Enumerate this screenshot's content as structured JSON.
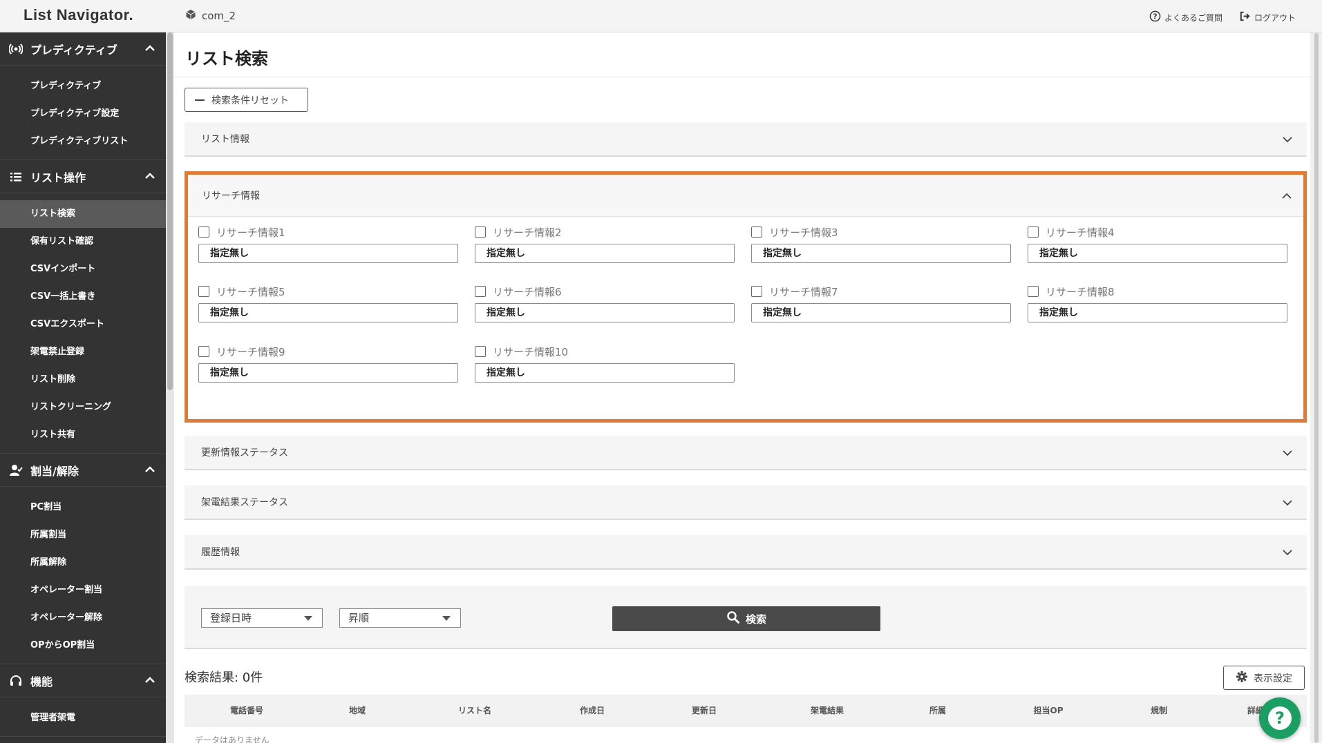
{
  "header": {
    "logo": "List Navigator.",
    "company": "com_2",
    "faq_label": "よくあるご質問",
    "logout_label": "ログアウト"
  },
  "sidebar": {
    "sections": [
      {
        "title": "プレディクティブ",
        "icon": "signal-icon",
        "items": [
          "プレディクティブ",
          "プレディクティブ設定",
          "プレディクティブリスト"
        ]
      },
      {
        "title": "リスト操作",
        "icon": "list-icon",
        "items": [
          "リスト検索",
          "保有リスト確認",
          "CSVインポート",
          "CSV一括上書き",
          "CSVエクスポート",
          "架電禁止登録",
          "リスト削除",
          "リストクリーニング",
          "リスト共有"
        ]
      },
      {
        "title": "割当/解除",
        "icon": "user-check-icon",
        "items": [
          "PC割当",
          "所属割当",
          "所属解除",
          "オペレーター割当",
          "オペレーター解除",
          "OPからOP割当"
        ]
      },
      {
        "title": "機能",
        "icon": "headset-icon",
        "items": [
          "管理者架電"
        ]
      }
    ],
    "active_item": "リスト検索"
  },
  "main": {
    "title": "リスト検索",
    "reset_label": "検索条件リセット",
    "accordions": {
      "list_info": "リスト情報",
      "research_info": "リサーチ情報",
      "update_status": "更新情報ステータス",
      "call_result_status": "架電結果ステータス",
      "history": "履歴情報"
    },
    "research_fields": [
      {
        "label": "リサーチ情報1",
        "value": "指定無し"
      },
      {
        "label": "リサーチ情報2",
        "value": "指定無し"
      },
      {
        "label": "リサーチ情報3",
        "value": "指定無し"
      },
      {
        "label": "リサーチ情報4",
        "value": "指定無し"
      },
      {
        "label": "リサーチ情報5",
        "value": "指定無し"
      },
      {
        "label": "リサーチ情報6",
        "value": "指定無し"
      },
      {
        "label": "リサーチ情報7",
        "value": "指定無し"
      },
      {
        "label": "リサーチ情報8",
        "value": "指定無し"
      },
      {
        "label": "リサーチ情報9",
        "value": "指定無し"
      },
      {
        "label": "リサーチ情報10",
        "value": "指定無し"
      }
    ],
    "sort_field": "登録日時",
    "sort_order": "昇順",
    "search_label": "検索",
    "result_title": "検索結果: 0件",
    "display_settings_label": "表示設定",
    "table_headers": [
      "電話番号",
      "地域",
      "リスト名",
      "作成日",
      "更新日",
      "架電結果",
      "所属",
      "担当OP",
      "規制",
      "詳細"
    ],
    "no_data": "データはありません"
  },
  "colors": {
    "sidebar_bg": "#333333",
    "highlight": "#e07b35",
    "help_fab": "#1a9e62",
    "search_button": "#4a4a4a"
  }
}
